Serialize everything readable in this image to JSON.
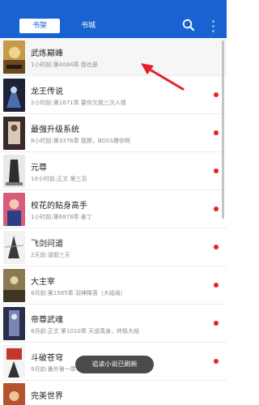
{
  "header": {
    "tab_shelf": "书架",
    "tab_store": "书城",
    "search_icon": "search-icon",
    "more_icon": "more-vertical-icon",
    "bg_color": "#1863d1"
  },
  "books": [
    {
      "title": "武炼巅峰",
      "meta": "1小时前:第4084章 我也是",
      "unread": false
    },
    {
      "title": "龙王传说",
      "meta": "2小时前:第1671章 要你欠我三次人情",
      "unread": true
    },
    {
      "title": "最强升级系统",
      "meta": "8小时前:第3376章 我擦，BOSS爆你啊",
      "unread": true
    },
    {
      "title": "元尊",
      "meta": "10小时前:正文 第三百",
      "unread": true
    },
    {
      "title": "校花的贴身高手",
      "meta": "1小时前:第6878章 悬丁",
      "unread": true
    },
    {
      "title": "飞剑问道",
      "meta": "2天前:请假三天",
      "unread": true
    },
    {
      "title": "大主宰",
      "meta": "8月前:第1565章 羽神降落（大结局）",
      "unread": true
    },
    {
      "title": "帝尊武魂",
      "meta": "8月前:正文 第1010章 天道真身，终极大结",
      "unread": true
    },
    {
      "title": "斗破苍穹",
      "meta": "9月前:番外第一章",
      "unread": true
    },
    {
      "title": "完美世界",
      "meta": "",
      "unread": false
    }
  ],
  "toast": "追读小说已刷新",
  "colors": {
    "unread_dot": "#e8202a",
    "annotation_arrow": "#e8202a"
  }
}
